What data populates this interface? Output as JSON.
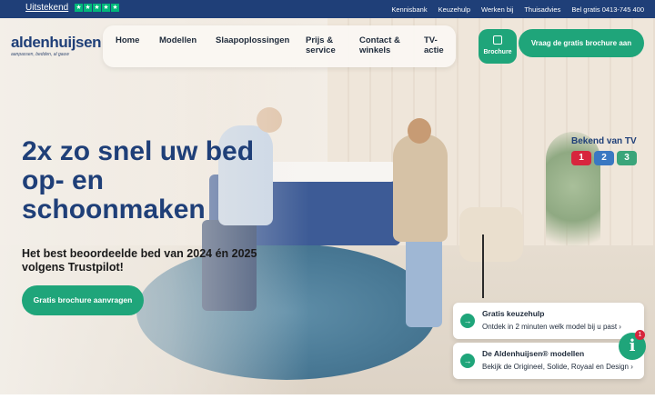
{
  "topbar": {
    "trustpilot_label": "Uitstekend",
    "stars": [
      "★",
      "★",
      "★",
      "★",
      "★"
    ],
    "links": [
      "Kennisbank",
      "Keuzehulp",
      "Werken bij",
      "Thuisadvies",
      "Bel gratis 0413-745 400"
    ]
  },
  "logo": {
    "name": "aldenhuijsen",
    "tagline": "aanpassen, bedden, al gauw"
  },
  "nav": {
    "items": [
      {
        "label": "Home"
      },
      {
        "label": "Modellen"
      },
      {
        "label": "Slaapoplossingen"
      },
      {
        "label": "Prijs & service"
      },
      {
        "label": "Contact & winkels"
      },
      {
        "label": "TV-actie"
      }
    ],
    "brochure_icon_label": "Brochure",
    "brochure_cta": "Vraag de gratis brochure aan"
  },
  "hero": {
    "headline": "2x zo snel uw bed op- en schoonmaken",
    "subhead": "Het best beoordeelde bed van 2024 én 2025 volgens Trustpilot!",
    "cta": "Gratis brochure aanvragen",
    "tv_label": "Bekend van TV",
    "tv_logos": [
      {
        "label": "1",
        "color": "#d7263d"
      },
      {
        "label": "2",
        "color": "#3a78c2"
      },
      {
        "label": "3",
        "color": "#3aa57a"
      }
    ]
  },
  "cards": [
    {
      "title": "Gratis keuzehulp",
      "text": "Ontdek in 2 minuten welk model bij u past ›",
      "arrow": "→"
    },
    {
      "title": "De Aldenhuijsen® modellen",
      "text": "Bekijk de Origineel, Solide, Royaal en Design ›",
      "arrow": "→"
    }
  ],
  "info_widget": {
    "icon": "i",
    "badge_count": "1"
  },
  "colors": {
    "brand_blue": "#1f3f78",
    "brand_green": "#1fa57a",
    "trustpilot_green": "#00b67a"
  }
}
